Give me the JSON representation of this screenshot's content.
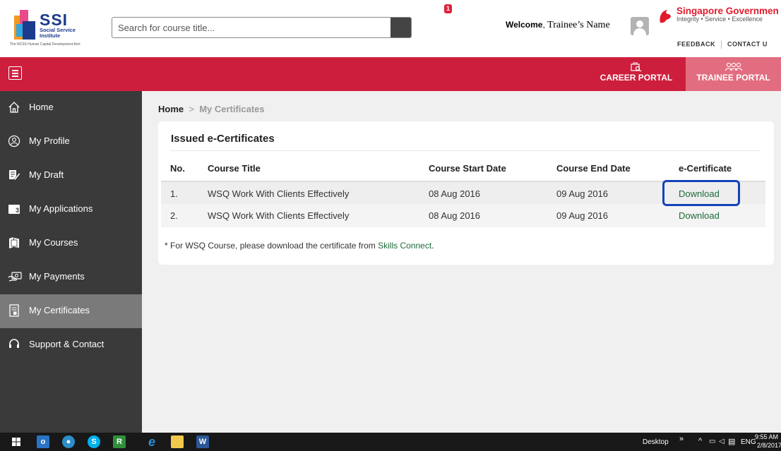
{
  "header": {
    "logo": {
      "name": "SSI",
      "subtitle_line1": "Social Service",
      "subtitle_line2": "Institute",
      "tagline": "The NCSS Human Capital Development Arm"
    },
    "search": {
      "placeholder": "Search for course title..."
    },
    "notification_count": "1",
    "welcome_label": "Welcome",
    "user_name": "Trainee’s Name",
    "gov": {
      "title": "Singapore Governmen",
      "tagline": "Integrity • Service • Excellence"
    },
    "links": {
      "feedback": "FEEDBACK",
      "contact": "CONTACT U"
    }
  },
  "redbar": {
    "career_portal": "CAREER PORTAL",
    "trainee_portal": "TRAINEE PORTAL",
    "accent": "#cd1f3d"
  },
  "sidebar": {
    "items": [
      {
        "label": "Home",
        "icon": "home-icon"
      },
      {
        "label": "My Profile",
        "icon": "profile-icon"
      },
      {
        "label": "My Draft",
        "icon": "draft-icon"
      },
      {
        "label": "My Applications",
        "icon": "applications-icon"
      },
      {
        "label": "My Courses",
        "icon": "courses-icon"
      },
      {
        "label": "My Payments",
        "icon": "payments-icon"
      },
      {
        "label": "My Certificates",
        "icon": "certificates-icon"
      },
      {
        "label": "Support & Contact",
        "icon": "support-icon"
      }
    ]
  },
  "main": {
    "breadcrumb": {
      "home": "Home",
      "separator": ">",
      "current": "My Certificates"
    },
    "card_title": "Issued e-Certificates",
    "columns": [
      "No.",
      "Course Title",
      "Course Start Date",
      "Course End Date",
      "e-Certificate"
    ],
    "rows": [
      {
        "no": "1.",
        "title": "WSQ Work With Clients Effectively",
        "start": "08 Aug 2016",
        "end": "09 Aug 2016",
        "cert": "Download"
      },
      {
        "no": "2.",
        "title": "WSQ Work With Clients Effectively",
        "start": "08 Aug 2016",
        "end": "09 Aug 2016",
        "cert": "Download"
      }
    ],
    "footnote_text": "* For WSQ Course, please download the certificate from ",
    "footnote_link": "Skills Connect",
    "footnote_end": "."
  },
  "taskbar": {
    "desktop": "Desktop",
    "lang": "ENG",
    "time": "9:55 AM",
    "date": "2/8/2017"
  }
}
